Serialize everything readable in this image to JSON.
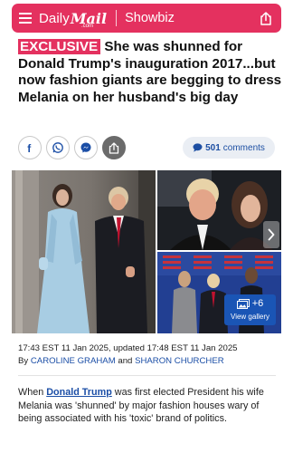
{
  "header": {
    "brand_part1": "Daily",
    "brand_part2": "Mail",
    "brand_dotcom": ".com",
    "section": "Showbiz",
    "color": "#e4315f"
  },
  "headline": {
    "badge": "EXCLUSIVE",
    "text": " She was shunned for Donald Trump's inauguration 2017...but now fashion giants are begging to dress Melania on her husband's big day"
  },
  "share": {
    "buttons": [
      "facebook-icon",
      "whatsapp-icon",
      "messenger-icon",
      "share-icon"
    ],
    "comments_count": "501",
    "comments_label": "comments"
  },
  "gallery": {
    "extra_count": "+6",
    "view_label": "View gallery"
  },
  "byline": {
    "timestamp": "17:43 EST 11 Jan 2025, updated 17:48 EST 11 Jan 2025",
    "by": "By",
    "author1": "CAROLINE GRAHAM",
    "and": "and",
    "author2": "SHARON CHURCHER"
  },
  "article": {
    "p1_before": "When ",
    "p1_link": "Donald Trump",
    "p1_after": " was first elected President his wife Melania was 'shunned' by major fashion houses wary of being associated with his 'toxic' brand of politics."
  }
}
